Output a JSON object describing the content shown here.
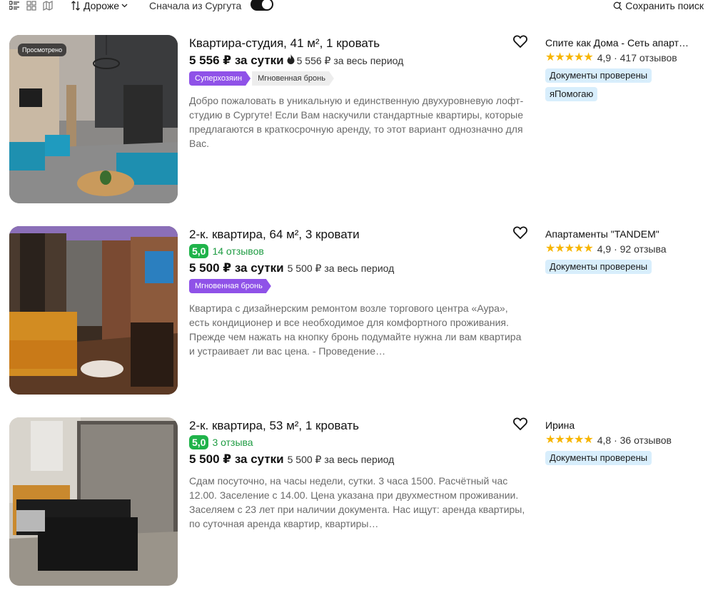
{
  "toolbar": {
    "sort_label": "Дороже",
    "surgut_label": "Сначала из Сургута",
    "surgut_toggle_on": true,
    "save_search_label": "Сохранить поиск"
  },
  "listings": [
    {
      "title": "Квартира-студия, 41 м², 1 кровать",
      "seen_label": "Просмотрено",
      "price_main": "5 556 ₽ за сутки",
      "price_total": "5 556 ₽ за весь период",
      "tags": [
        "Суперхозяин",
        "Мгновенная бронь"
      ],
      "description": "Добро пожаловать в уникальную и единственную двухуровневую лофт-студию в Сургуте! Если Вам наскучили стандартные квартиры, которые предлагаются в краткосрочную аренду, то этот вариант однозначно для Вас.",
      "host_name": "Спите как Дома - Сеть апарт…",
      "host_rating": "4,9 · 417 отзывов",
      "host_badges": [
        "Документы проверены",
        "яПомогаю"
      ]
    },
    {
      "title": "2-к. квартира, 64 м², 3 кровати",
      "rating": "5,0",
      "reviews": "14 отзывов",
      "price_main": "5 500 ₽ за сутки",
      "price_total": "5 500 ₽ за весь период",
      "tags": [
        "Мгновенная бронь"
      ],
      "description": "Квартира с дизайнерским ремонтом возле торгового центра «Аура», есть кондиционер и все необходимое для комфортного проживания. Прежде чем нажать на кнопку бронь подумайте нужна ли вам квартира и устраивает ли вас цена. - Проведение…",
      "host_name": "Апартаменты \"TANDEM\"",
      "host_rating": "4,9 · 92 отзыва",
      "host_badges": [
        "Документы проверены"
      ]
    },
    {
      "title": "2-к. квартира, 53 м², 1 кровать",
      "rating": "5,0",
      "reviews": "3 отзыва",
      "price_main": "5 500 ₽ за сутки",
      "price_total": "5 500 ₽ за весь период",
      "description": "Сдам посуточно, на часы недели, сутки. 3 часа 1500. Расчётный час 12.00. Заселение с 14.00. Цена указана при двухместном проживании. Заселяем с 23 лет при наличии документа. Нас ищут: аренда квартиры, по суточная аренда квартир, квартиры…",
      "host_name": "Ирина",
      "host_rating": "4,8 · 36 отзывов",
      "host_badges": [
        "Документы проверены"
      ]
    }
  ],
  "colors": {
    "rating_green": "#1fb34a",
    "tag_purple": "#8f52e8",
    "star_yellow": "#f7b500",
    "badge_blue": "#d8eefc"
  },
  "icons": [
    "list-view-icon",
    "grid-view-icon",
    "map-view-icon",
    "sort-icon",
    "chevron-down-icon",
    "save-search-icon",
    "fire-icon",
    "heart-icon",
    "star-icon"
  ]
}
